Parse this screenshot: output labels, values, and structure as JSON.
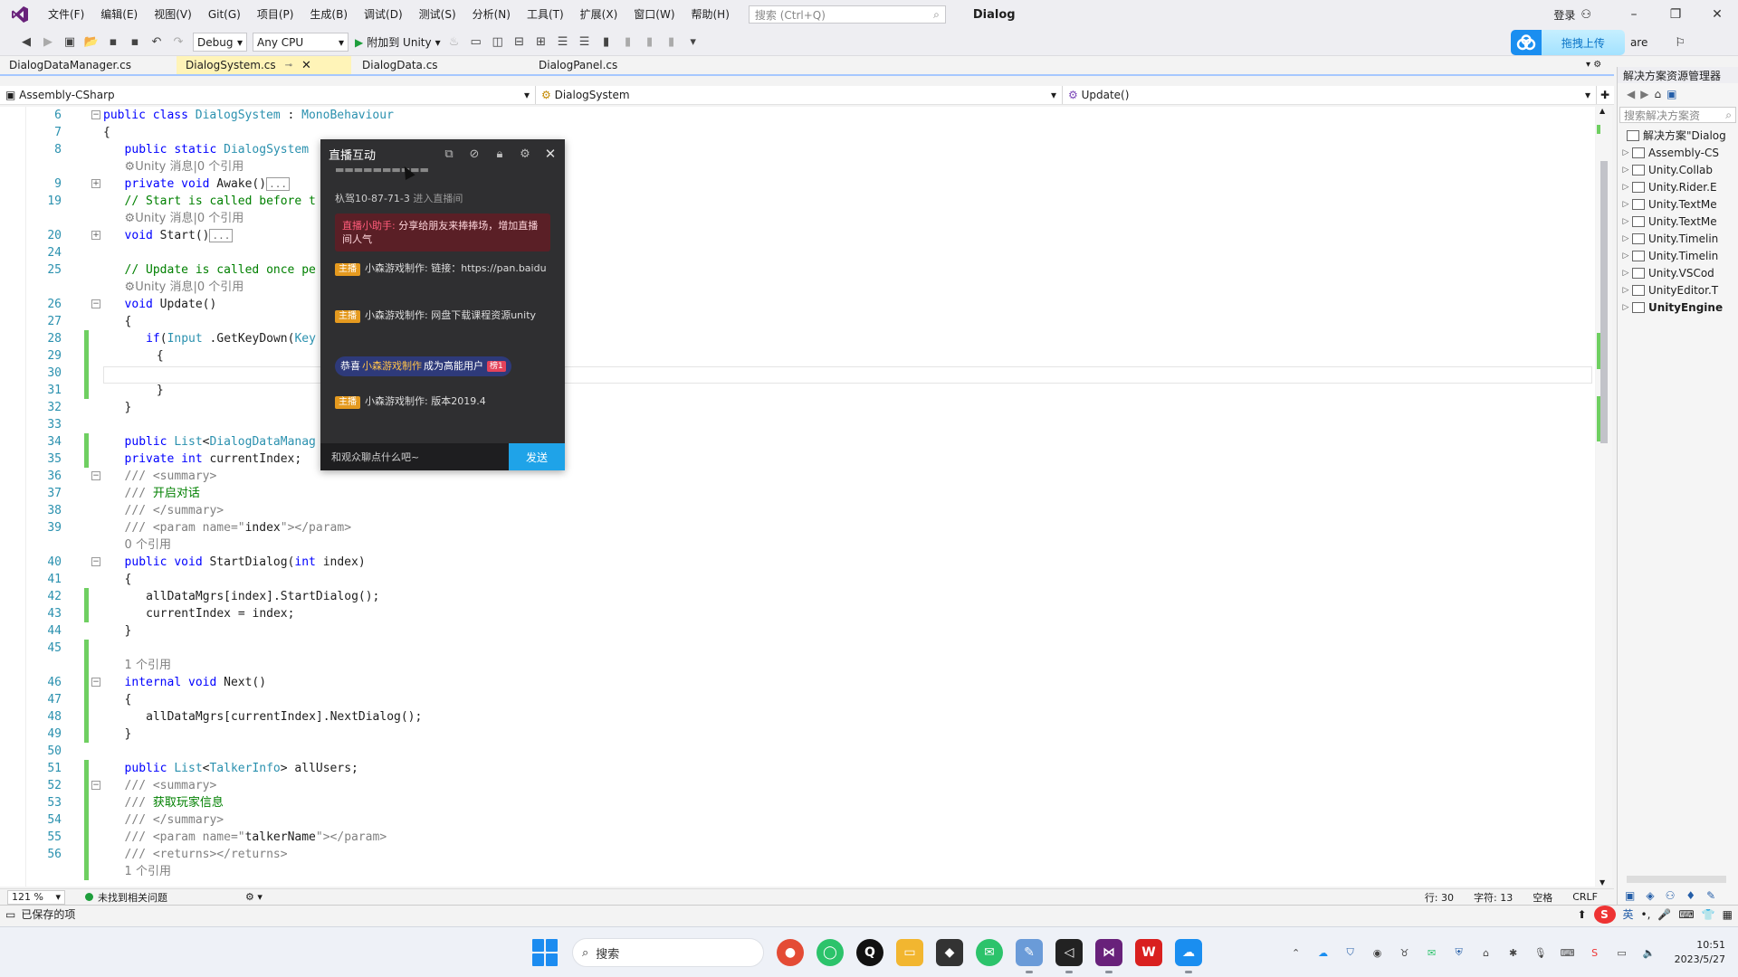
{
  "titlebar": {
    "menus": [
      "文件(F)",
      "编辑(E)",
      "视图(V)",
      "Git(G)",
      "项目(P)",
      "生成(B)",
      "调试(D)",
      "测试(S)",
      "分析(N)",
      "工具(T)",
      "扩展(X)",
      "窗口(W)",
      "帮助(H)"
    ],
    "search_placeholder": "搜索 (Ctrl+Q)",
    "solution_name": "Dialog",
    "login": "登录"
  },
  "toolbar": {
    "config": "Debug",
    "platform": "Any CPU",
    "attach_label": "附加到 Unity",
    "upload_label": "拖拽上传",
    "share_label": "are"
  },
  "tabs": [
    {
      "label": "DialogDataManager.cs",
      "active": false
    },
    {
      "label": "DialogSystem.cs",
      "active": true
    },
    {
      "label": "DialogData.cs",
      "active": false
    },
    {
      "label": "DialogPanel.cs",
      "active": false
    }
  ],
  "nav": {
    "project": "Assembly-CSharp",
    "type": "DialogSystem",
    "member": "Update()"
  },
  "code_lines": [
    {
      "n": "6",
      "html": "<span class=\"kw\">public class</span> <span class=\"ty\">DialogSystem</span> : <span class=\"ty\">MonoBehaviour</span>",
      "indent": 0,
      "fold": "−",
      "chg": false
    },
    {
      "n": "7",
      "html": "{",
      "indent": 0,
      "fold": "",
      "chg": false
    },
    {
      "n": "8",
      "html": "<span class=\"kw\">public static</span> <span class=\"ty\">DialogSystem</span>",
      "indent": 2,
      "fold": "",
      "chg": false
    },
    {
      "n": "",
      "html": "<span class=\"lens\">⚙Unity 消息|0 个引用</span>",
      "indent": 2,
      "fold": "",
      "chg": false
    },
    {
      "n": "9",
      "html": "<span class=\"kw\">private void</span> Awake()<span class=\"collapsed-box\">...</span>",
      "indent": 2,
      "fold": "+",
      "chg": false
    },
    {
      "n": "19",
      "html": "<span class=\"cm\">// Start is called before t</span>",
      "indent": 2,
      "fold": "",
      "chg": false
    },
    {
      "n": "",
      "html": "<span class=\"lens\">⚙Unity 消息|0 个引用</span>",
      "indent": 2,
      "fold": "",
      "chg": false
    },
    {
      "n": "20",
      "html": "<span class=\"kw\">void</span> Start()<span class=\"collapsed-box\">...</span>",
      "indent": 2,
      "fold": "+",
      "chg": false
    },
    {
      "n": "24",
      "html": "",
      "indent": 2,
      "fold": "",
      "chg": false
    },
    {
      "n": "25",
      "html": "<span class=\"cm\">// Update is called once pe</span>",
      "indent": 2,
      "fold": "",
      "chg": false
    },
    {
      "n": "",
      "html": "<span class=\"lens\">⚙Unity 消息|0 个引用</span>",
      "indent": 2,
      "fold": "",
      "chg": false
    },
    {
      "n": "26",
      "html": "<span class=\"kw\">void</span> Update()",
      "indent": 2,
      "fold": "−",
      "chg": false
    },
    {
      "n": "27",
      "html": "{",
      "indent": 2,
      "fold": "",
      "chg": false
    },
    {
      "n": "28",
      "html": "<span class=\"kw\">if</span>(<span class=\"ty\">Input</span> .GetKeyDown(<span class=\"ty\">Key</span>",
      "indent": 4,
      "fold": "",
      "chg": true
    },
    {
      "n": "29",
      "html": "{",
      "indent": 5,
      "fold": "",
      "chg": true
    },
    {
      "n": "30",
      "html": "",
      "indent": 6,
      "fold": "",
      "chg": true
    },
    {
      "n": "31",
      "html": "}",
      "indent": 5,
      "fold": "",
      "chg": true
    },
    {
      "n": "32",
      "html": "}",
      "indent": 2,
      "fold": "",
      "chg": false
    },
    {
      "n": "33",
      "html": "",
      "indent": 2,
      "fold": "",
      "chg": false
    },
    {
      "n": "34",
      "html": "<span class=\"kw\">public</span> <span class=\"ty\">List</span>&lt;<span class=\"ty\">DialogDataManag</span>",
      "indent": 2,
      "fold": "",
      "chg": true
    },
    {
      "n": "35",
      "html": "<span class=\"kw\">private int</span> currentIndex;",
      "indent": 2,
      "fold": "",
      "chg": true
    },
    {
      "n": "36",
      "html": "<span class=\"gray\">/// &lt;summary&gt;</span>",
      "indent": 2,
      "fold": "−",
      "chg": false
    },
    {
      "n": "37",
      "html": "<span class=\"gray\">///</span> <span class=\"cm\">开启对话</span>",
      "indent": 2,
      "fold": "",
      "chg": false
    },
    {
      "n": "38",
      "html": "<span class=\"gray\">/// &lt;/summary&gt;</span>",
      "indent": 2,
      "fold": "",
      "chg": false
    },
    {
      "n": "39",
      "html": "<span class=\"gray\">/// &lt;param name=\"</span>index<span class=\"gray\">\"&gt;&lt;/param&gt;</span>",
      "indent": 2,
      "fold": "",
      "chg": false
    },
    {
      "n": "",
      "html": "<span class=\"lens\">0 个引用</span>",
      "indent": 2,
      "fold": "",
      "chg": false
    },
    {
      "n": "40",
      "html": "<span class=\"kw\">public void</span> StartDialog(<span class=\"kw\">int</span> index)",
      "indent": 2,
      "fold": "−",
      "chg": false
    },
    {
      "n": "41",
      "html": "{",
      "indent": 2,
      "fold": "",
      "chg": false
    },
    {
      "n": "42",
      "html": "allDataMgrs[index].StartDialog();",
      "indent": 4,
      "fold": "",
      "chg": true
    },
    {
      "n": "43",
      "html": "currentIndex = index;",
      "indent": 4,
      "fold": "",
      "chg": true
    },
    {
      "n": "44",
      "html": "}",
      "indent": 2,
      "fold": "",
      "chg": false
    },
    {
      "n": "45",
      "html": "",
      "indent": 2,
      "fold": "",
      "chg": true
    },
    {
      "n": "",
      "html": "<span class=\"lens\">1 个引用</span>",
      "indent": 2,
      "fold": "",
      "chg": true
    },
    {
      "n": "46",
      "html": "<span class=\"kw\">internal void</span> Next()",
      "indent": 2,
      "fold": "−",
      "chg": true
    },
    {
      "n": "47",
      "html": "{",
      "indent": 2,
      "fold": "",
      "chg": true
    },
    {
      "n": "48",
      "html": "allDataMgrs[currentIndex].NextDialog();",
      "indent": 4,
      "fold": "",
      "chg": true
    },
    {
      "n": "49",
      "html": "}",
      "indent": 2,
      "fold": "",
      "chg": true
    },
    {
      "n": "50",
      "html": "",
      "indent": 2,
      "fold": "",
      "chg": false
    },
    {
      "n": "51",
      "html": "<span class=\"kw\">public</span> <span class=\"ty\">List</span>&lt;<span class=\"ty\">TalkerInfo</span>&gt; allUsers;",
      "indent": 2,
      "fold": "",
      "chg": true
    },
    {
      "n": "52",
      "html": "<span class=\"gray\">/// &lt;summary&gt;</span>",
      "indent": 2,
      "fold": "−",
      "chg": true
    },
    {
      "n": "53",
      "html": "<span class=\"gray\">///</span> <span class=\"cm\">获取玩家信息</span>",
      "indent": 2,
      "fold": "",
      "chg": true
    },
    {
      "n": "54",
      "html": "<span class=\"gray\">/// &lt;/summary&gt;</span>",
      "indent": 2,
      "fold": "",
      "chg": true
    },
    {
      "n": "55",
      "html": "<span class=\"gray\">/// &lt;param name=\"</span>talkerName<span class=\"gray\">\"&gt;&lt;/param&gt;</span>",
      "indent": 2,
      "fold": "",
      "chg": true
    },
    {
      "n": "56",
      "html": "<span class=\"gray\">/// &lt;returns&gt;&lt;/returns&gt;</span>",
      "indent": 2,
      "fold": "",
      "chg": true
    },
    {
      "n": "",
      "html": "<span class=\"lens\">1 个引用</span>",
      "indent": 2,
      "fold": "",
      "chg": true
    }
  ],
  "editor_status": {
    "zoom": "121 %",
    "issues": "未找到相关问题",
    "line": "行: 30",
    "char": "字符: 13",
    "space": "空格",
    "eol": "CRLF"
  },
  "solution_explorer": {
    "title": "解决方案资源管理器",
    "search_placeholder": "搜索解决方案资",
    "root": "解决方案\"Dialog",
    "items": [
      "Assembly-CS",
      "Unity.Collab",
      "Unity.Rider.E",
      "Unity.TextMe",
      "Unity.TextMe",
      "Unity.Timelin",
      "Unity.Timelin",
      "Unity.VSCod",
      "UnityEditor.T",
      "UnityEngine"
    ]
  },
  "app_status": {
    "text": "已保存的项",
    "ime": "英"
  },
  "taskbar": {
    "search_label": "搜索",
    "time": "10:51",
    "date": "2023/5/27"
  },
  "live": {
    "title": "直播互动",
    "enter_user": "杁驾10-87-71-3",
    "enter_suffix": "进入直播间",
    "helper_name": "直播小助手:",
    "helper_text": "分享给朋友来捧捧场，增加直播间人气",
    "host_badge": "主播",
    "msg1": "小森游戏制作: 链接：https://pan.baidu",
    "msg2": "小森游戏制作: 网盘下载课程资源unity",
    "gift_prefix": "恭喜",
    "gift_user": "小森游戏制作",
    "gift_suffix": "成为高能用户",
    "gift_level": "榜1",
    "msg3": "小森游戏制作: 版本2019.4",
    "input_placeholder": "和观众聊点什么吧~",
    "send_label": "发送"
  },
  "colors": {
    "vs_purple": "#68217a",
    "change_green": "#6fcf61",
    "send_blue": "#1fa3e8",
    "host_orange": "#e59a1f"
  }
}
